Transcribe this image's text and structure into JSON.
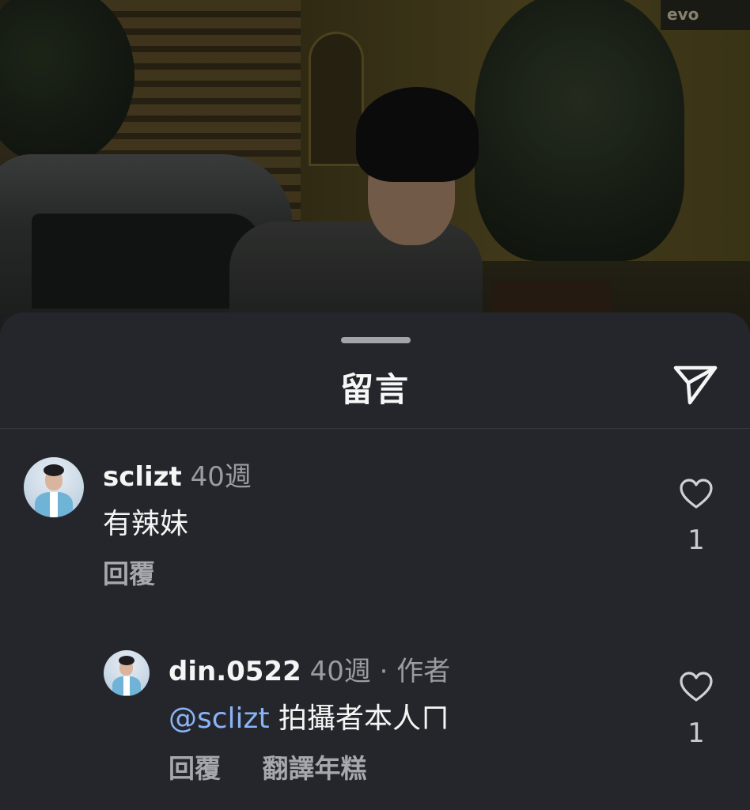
{
  "background": {
    "sign_text": "evo"
  },
  "sheet": {
    "title": "留言"
  },
  "comments": [
    {
      "username": "sclizt",
      "time": "40週",
      "author_tag": "",
      "mention": "",
      "text": "有辣妹",
      "actions": [
        "回覆"
      ],
      "likes": "1"
    },
    {
      "username": "din.0522",
      "time": "40週",
      "author_tag": "· 作者",
      "mention": "@sclizt",
      "text": "拍攝者本人ㄇ",
      "actions": [
        "回覆",
        "翻譯年糕"
      ],
      "likes": "1"
    }
  ],
  "icons": {
    "share": "paper-plane-icon",
    "like": "heart-outline-icon",
    "grabber": "drag-handle"
  },
  "colors": {
    "sheet_bg": "#25262b",
    "mention": "#8ab4f8",
    "muted": "#9a9ca2"
  }
}
